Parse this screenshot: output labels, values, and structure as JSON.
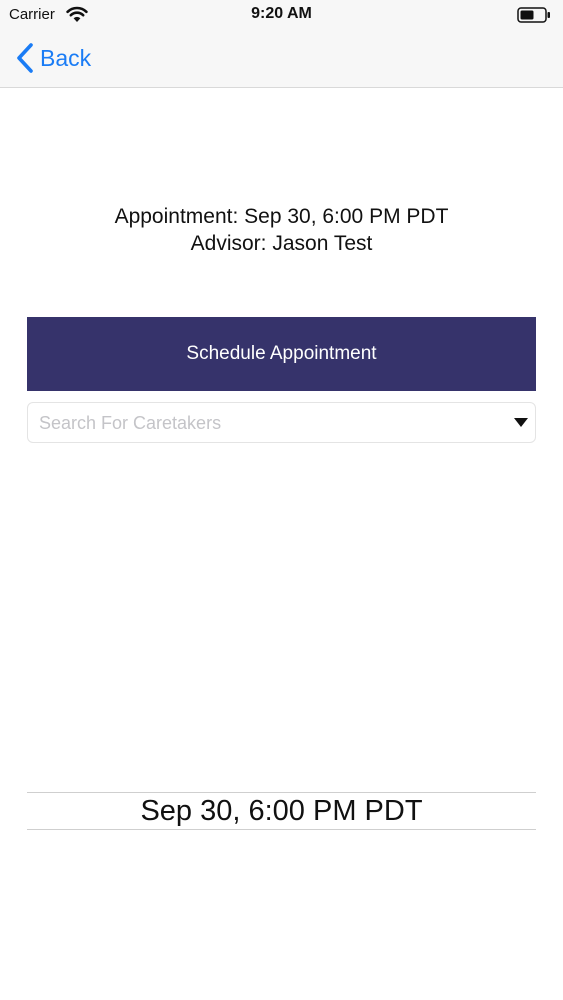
{
  "status_bar": {
    "carrier": "Carrier",
    "time": "9:20 AM"
  },
  "nav": {
    "back_label": "Back"
  },
  "appointment": {
    "appointment_line": "Appointment: Sep 30, 6:00 PM PDT",
    "advisor_line": "Advisor: Jason Test"
  },
  "schedule_button": {
    "label": "Schedule Appointment"
  },
  "search": {
    "placeholder": "Search For Caretakers",
    "value": ""
  },
  "date_picker": {
    "selected_value": "Sep 30, 6:00 PM PDT"
  },
  "colors": {
    "accent_blue": "#1a7cf5",
    "button_background": "#36336b",
    "button_text": "#ffffff"
  },
  "icons": {
    "back": "chevron-left-icon",
    "wifi": "wifi-icon",
    "battery": "battery-icon",
    "dropdown": "caret-down-icon"
  }
}
